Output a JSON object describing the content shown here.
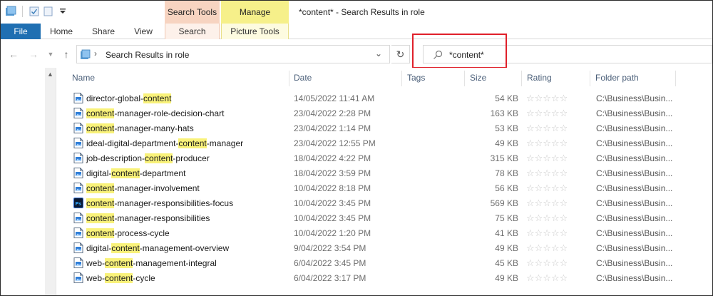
{
  "window": {
    "title": "*content* - Search Results in role"
  },
  "context_tabs": {
    "search_tools": "Search Tools",
    "manage": "Manage"
  },
  "ribbon": {
    "file": "File",
    "tabs": [
      "Home",
      "Share",
      "View",
      "Search",
      "Picture Tools"
    ]
  },
  "address": {
    "path": "Search Results in role"
  },
  "search": {
    "query": "*content*",
    "term": "content"
  },
  "columns": [
    "Name",
    "Date",
    "Tags",
    "Size",
    "Rating",
    "Folder path"
  ],
  "rating_stars": "☆☆☆☆☆",
  "files": [
    {
      "name": "director-global-content",
      "date": "14/05/2022 11:41 AM",
      "size": "54 KB",
      "path": "C:\\Business\\Busin...",
      "icon": "image-file-icon"
    },
    {
      "name": "content-manager-role-decision-chart",
      "date": "23/04/2022 2:28 PM",
      "size": "163 KB",
      "path": "C:\\Business\\Busin...",
      "icon": "image-file-icon"
    },
    {
      "name": "content-manager-many-hats",
      "date": "23/04/2022 1:14 PM",
      "size": "53 KB",
      "path": "C:\\Business\\Busin...",
      "icon": "image-file-icon"
    },
    {
      "name": "ideal-digital-department-content-manager",
      "date": "23/04/2022 12:55 PM",
      "size": "49 KB",
      "path": "C:\\Business\\Busin...",
      "icon": "image-file-icon"
    },
    {
      "name": "job-description-content-producer",
      "date": "18/04/2022 4:22 PM",
      "size": "315 KB",
      "path": "C:\\Business\\Busin...",
      "icon": "image-file-icon"
    },
    {
      "name": "digital-content-department",
      "date": "18/04/2022 3:59 PM",
      "size": "78 KB",
      "path": "C:\\Business\\Busin...",
      "icon": "image-file-icon"
    },
    {
      "name": "content-manager-involvement",
      "date": "10/04/2022 8:18 PM",
      "size": "56 KB",
      "path": "C:\\Business\\Busin...",
      "icon": "image-file-icon"
    },
    {
      "name": "content-manager-responsibilities-focus",
      "date": "10/04/2022 3:45 PM",
      "size": "569 KB",
      "path": "C:\\Business\\Busin...",
      "icon": "photoshop-file-icon"
    },
    {
      "name": "content-manager-responsibilities",
      "date": "10/04/2022 3:45 PM",
      "size": "75 KB",
      "path": "C:\\Business\\Busin...",
      "icon": "image-file-icon"
    },
    {
      "name": "content-process-cycle",
      "date": "10/04/2022 1:20 PM",
      "size": "41 KB",
      "path": "C:\\Business\\Busin...",
      "icon": "image-file-icon"
    },
    {
      "name": "digital-content-management-overview",
      "date": "9/04/2022 3:54 PM",
      "size": "49 KB",
      "path": "C:\\Business\\Busin...",
      "icon": "image-file-icon"
    },
    {
      "name": "web-content-management-integral",
      "date": "6/04/2022 3:45 PM",
      "size": "45 KB",
      "path": "C:\\Business\\Busin...",
      "icon": "image-file-icon"
    },
    {
      "name": "web-content-cycle",
      "date": "6/04/2022 3:17 PM",
      "size": "49 KB",
      "path": "C:\\Business\\Busin...",
      "icon": "image-file-icon"
    }
  ],
  "colors": {
    "file_tab": "#1f6fb2",
    "search_tools_tab": "#f7d4c1",
    "manage_tab": "#f6f08a",
    "match_highlight": "#f9f27a",
    "annotation_box": "#e0202a"
  }
}
